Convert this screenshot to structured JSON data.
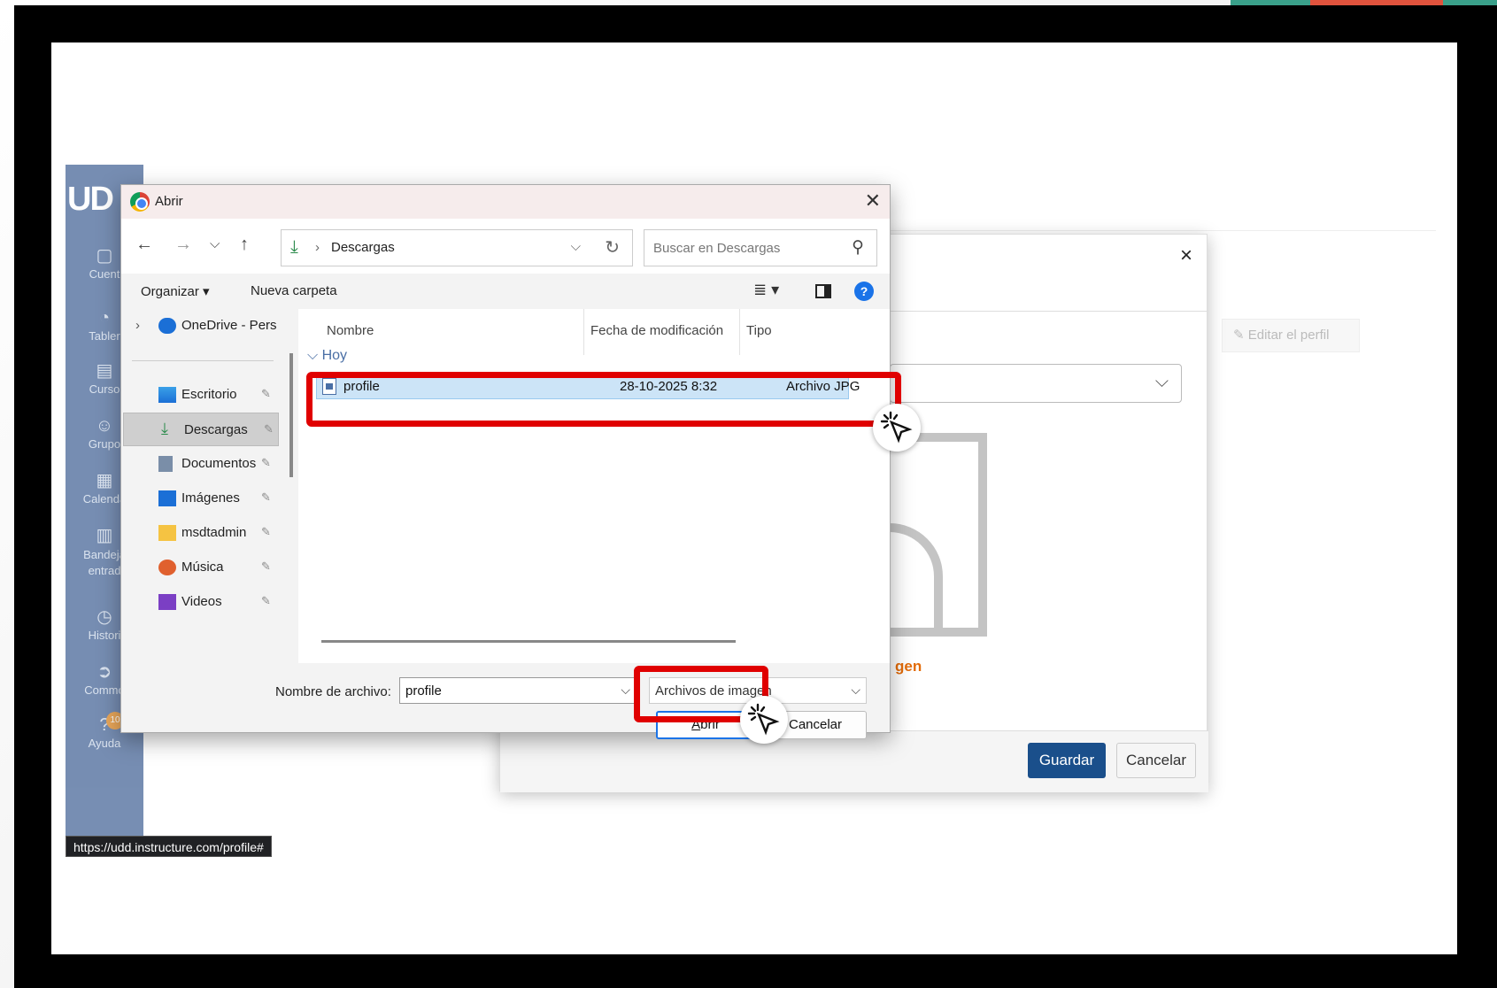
{
  "dialog": {
    "title": "Abrir",
    "address_folder": "Descargas",
    "search_placeholder": "Buscar en Descargas",
    "toolbar": {
      "organize": "Organizar ▾",
      "new_folder": "Nueva carpeta"
    },
    "sidebar": [
      {
        "label": "OneDrive - Pers",
        "icon": "cloud-icon"
      },
      {
        "label": "Escritorio",
        "icon": "desktop-icon"
      },
      {
        "label": "Descargas",
        "icon": "download-icon"
      },
      {
        "label": "Documentos",
        "icon": "document-icon"
      },
      {
        "label": "Imágenes",
        "icon": "image-icon"
      },
      {
        "label": "msdtadmin",
        "icon": "folder-icon"
      },
      {
        "label": "Música",
        "icon": "music-icon"
      },
      {
        "label": "Videos",
        "icon": "video-icon"
      }
    ],
    "columns": {
      "name": "Nombre",
      "date": "Fecha de modificación",
      "type": "Tipo"
    },
    "group": "Hoy",
    "file": {
      "name": "profile",
      "date": "28-10-2025 8:32",
      "type": "Archivo JPG"
    },
    "filename_label": "Nombre de archivo:",
    "filename_value": "profile",
    "filetype_value": "Archivos de imagen",
    "open_button": "Abrir",
    "cancel_button": "Cancelar"
  },
  "background": {
    "edit_profile": "✎ Editar el perfil",
    "image_link_fragment": "gen",
    "save_button": "Guardar",
    "cancel_button": "Cancelar",
    "status_url": "https://udd.instructure.com/profile#",
    "nav": [
      {
        "label": "Cuent"
      },
      {
        "label": "Tabler"
      },
      {
        "label": "Curso"
      },
      {
        "label": "Grupo"
      },
      {
        "label": "Calenda"
      },
      {
        "label": "Bandeja entrad"
      },
      {
        "label": "Histori"
      },
      {
        "label": "Commo"
      },
      {
        "label": "Ayuda",
        "badge": "10"
      }
    ],
    "logo": "UD",
    "close_symbol": "×"
  },
  "colors": {
    "highlight": "#e00000",
    "canvas_nav": "#6b84ac",
    "save": "#1a4f8b",
    "selection": "#cce4f7"
  }
}
